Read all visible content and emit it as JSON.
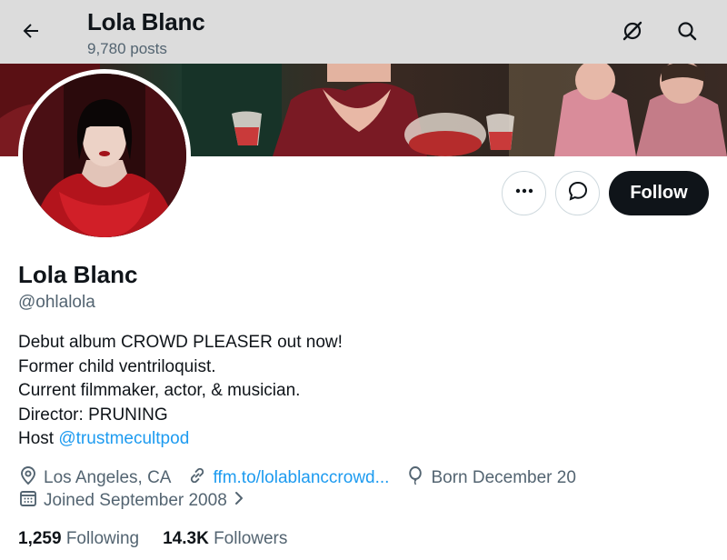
{
  "header": {
    "title": "Lola Blanc",
    "post_count": "9,780 posts",
    "back_icon": "arrow-left-icon",
    "grok_icon": "grok-icon",
    "search_icon": "search-icon",
    "background": "#dcdcdc"
  },
  "profile": {
    "name": "Lola Blanc",
    "handle": "@ohlalola",
    "bio_lines": [
      "Debut album CROWD PLEASER out now!",
      "Former child ventriloquist.",
      "Current filmmaker, actor, & musician.",
      "Director: PRUNING"
    ],
    "bio_host_prefix": "Host ",
    "bio_host_link": "@trustmecultpod",
    "location": "Los Angeles, CA",
    "website": "ffm.to/lolablanccrowd...",
    "birthday": "Born December 20",
    "joined": "Joined September 2008"
  },
  "actions": {
    "more_icon": "more-icon",
    "message_icon": "message-icon",
    "follow_label": "Follow"
  },
  "stats": {
    "following_count": "1,259",
    "following_label": "Following",
    "followers_count": "14.3K",
    "followers_label": "Followers"
  },
  "colors": {
    "accent": "#1d9bf0",
    "text": "#0f1419",
    "muted": "#536471",
    "follow_bg": "#0f1419"
  }
}
